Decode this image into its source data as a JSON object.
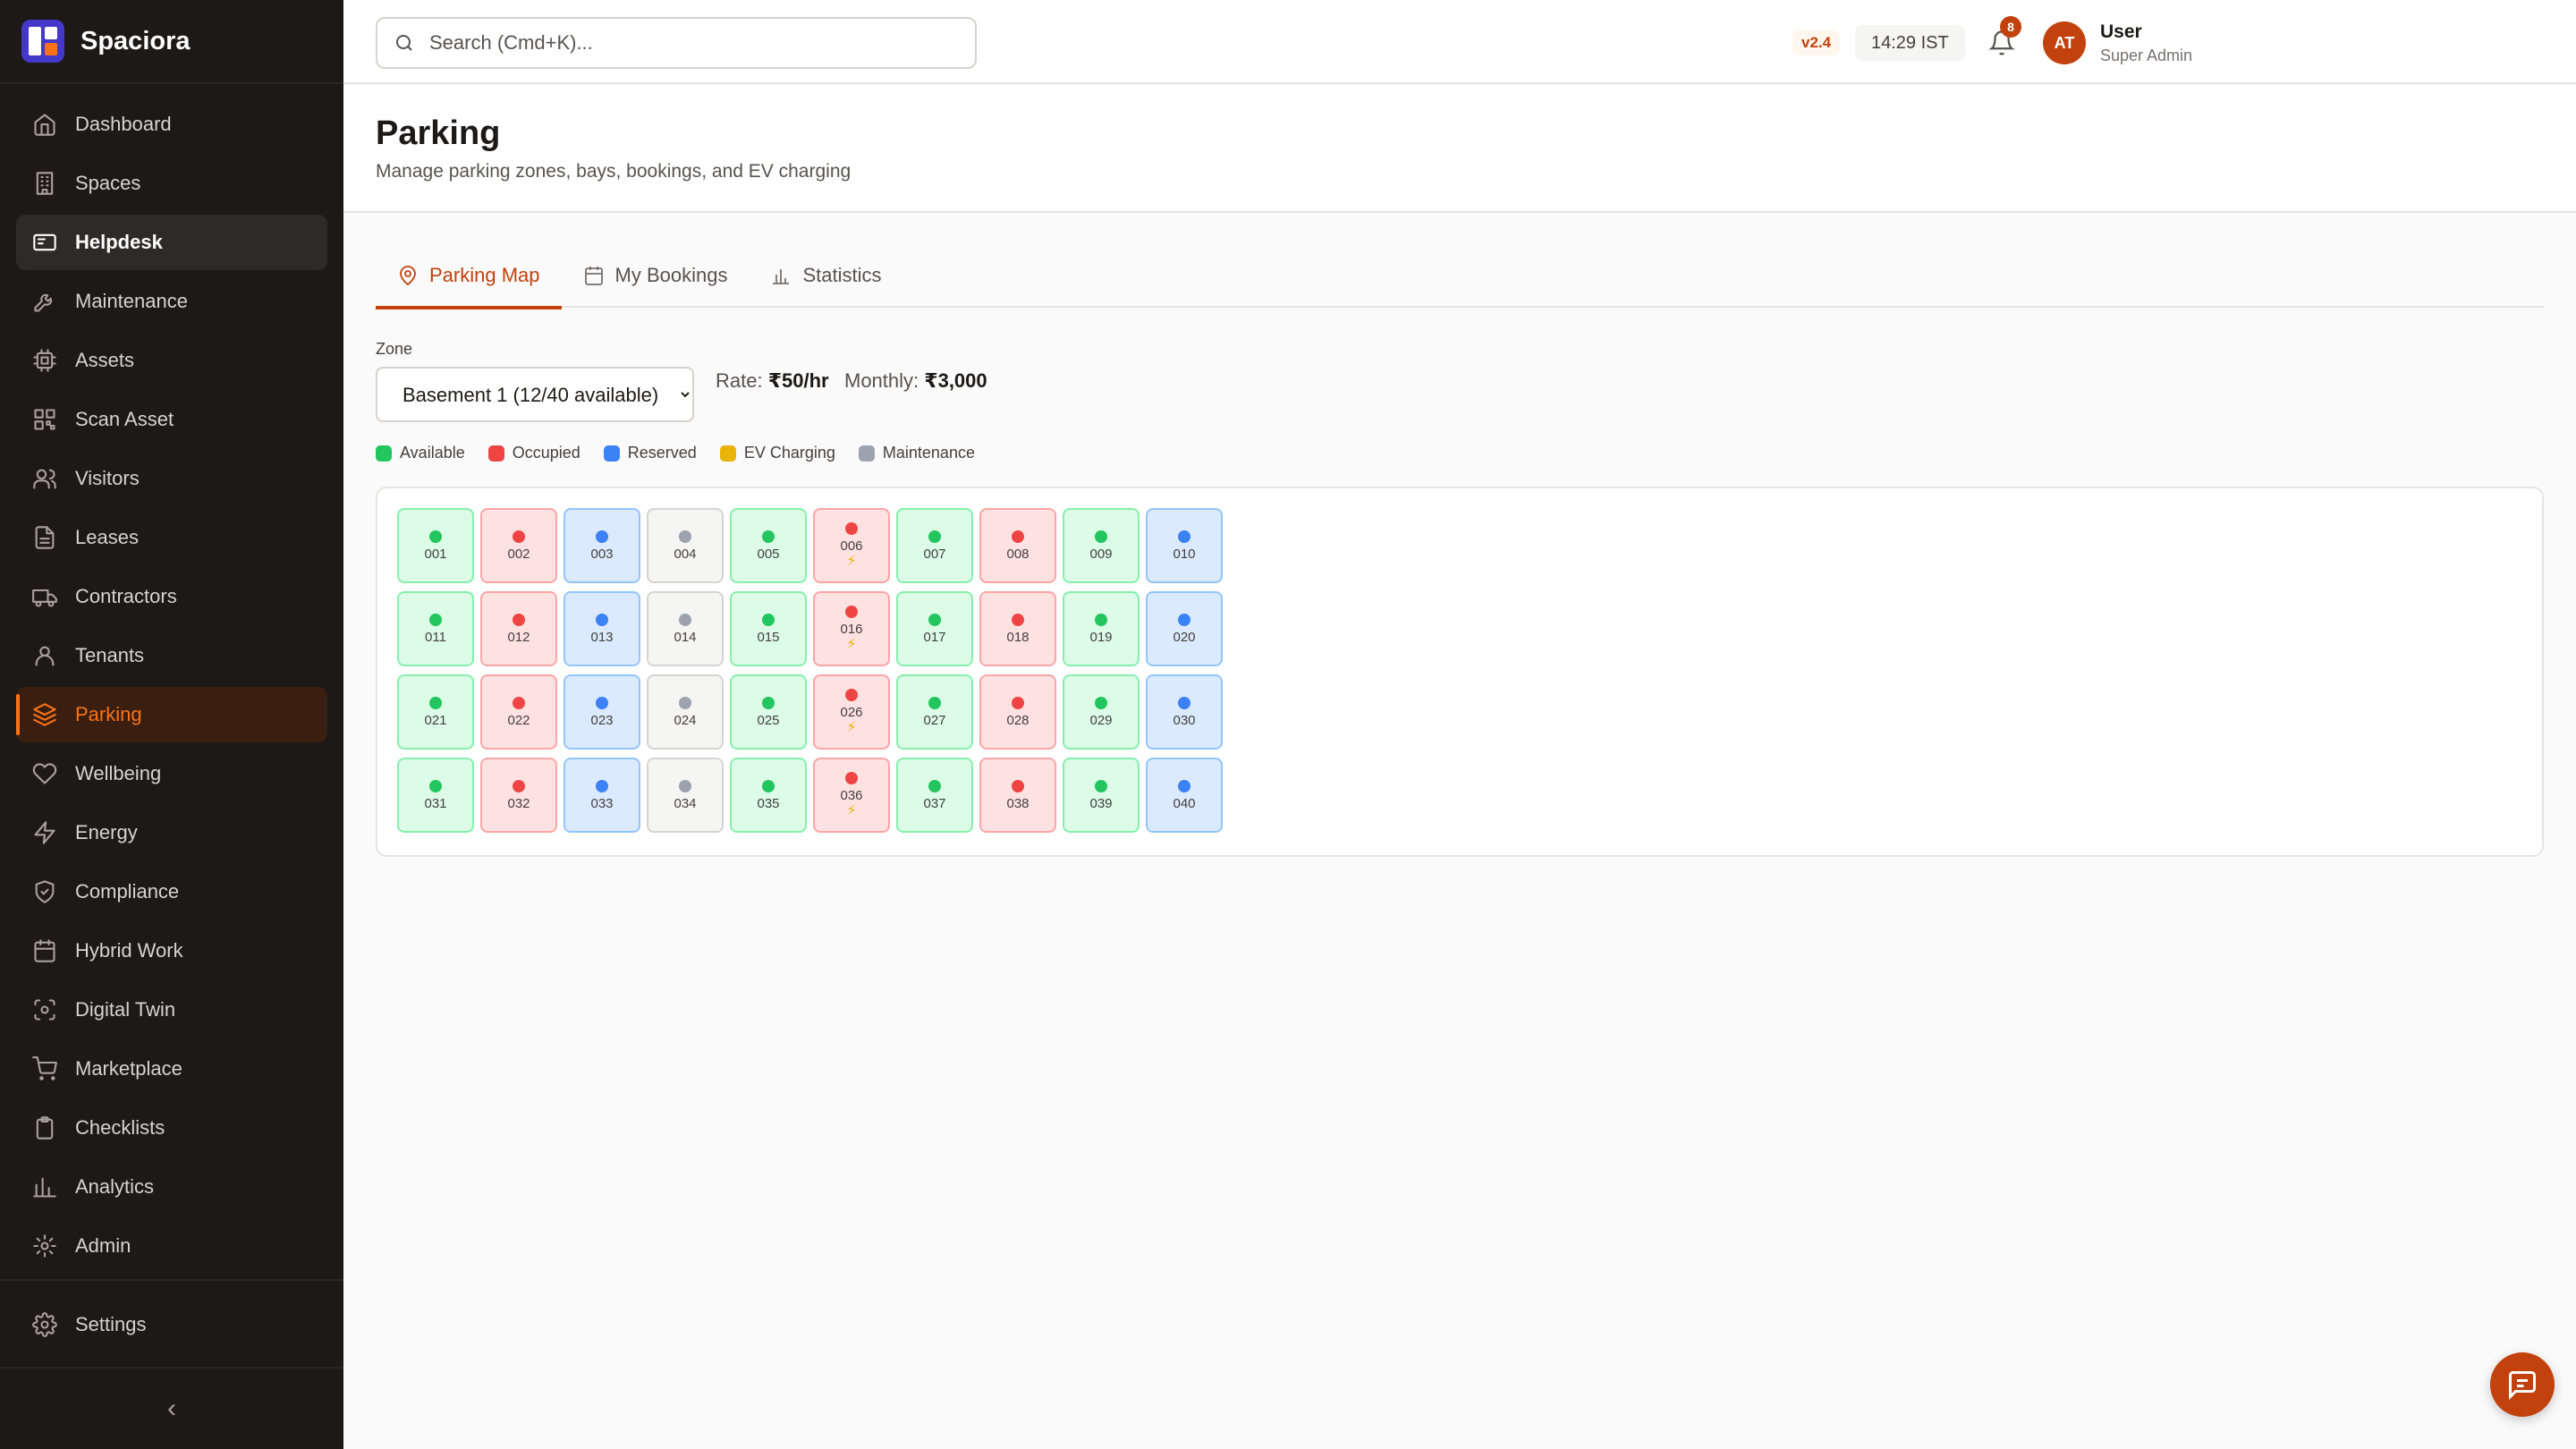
{
  "app": {
    "name": "Spaciora"
  },
  "sidebar": {
    "items": [
      {
        "label": "Dashboard",
        "icon": "home-icon"
      },
      {
        "label": "Spaces",
        "icon": "building-icon"
      },
      {
        "label": "Helpdesk",
        "icon": "ticket-icon"
      },
      {
        "label": "Maintenance",
        "icon": "wrench-icon"
      },
      {
        "label": "Assets",
        "icon": "cpu-icon"
      },
      {
        "label": "Scan Asset",
        "icon": "qr-icon"
      },
      {
        "label": "Visitors",
        "icon": "users-icon"
      },
      {
        "label": "Leases",
        "icon": "file-icon"
      },
      {
        "label": "Contractors",
        "icon": "truck-icon"
      },
      {
        "label": "Tenants",
        "icon": "user-icon"
      },
      {
        "label": "Parking",
        "icon": "layers-icon"
      },
      {
        "label": "Wellbeing",
        "icon": "heart-icon"
      },
      {
        "label": "Energy",
        "icon": "bolt-icon"
      },
      {
        "label": "Compliance",
        "icon": "shield-icon"
      },
      {
        "label": "Hybrid Work",
        "icon": "calendar-icon"
      },
      {
        "label": "Digital Twin",
        "icon": "box-icon"
      },
      {
        "label": "Marketplace",
        "icon": "cart-icon"
      },
      {
        "label": "Checklists",
        "icon": "clipboard-icon"
      },
      {
        "label": "Analytics",
        "icon": "chart-icon"
      },
      {
        "label": "Admin",
        "icon": "gear-icon"
      }
    ],
    "settings_label": "Settings",
    "active": "Parking",
    "hovered": "Helpdesk"
  },
  "topbar": {
    "search_placeholder": "Search (Cmd+K)...",
    "version": "v2.4",
    "time": "14:29 IST",
    "notification_count": "8",
    "user": {
      "initials": "AT",
      "name": "User",
      "role": "Super Admin"
    }
  },
  "page": {
    "title": "Parking",
    "subtitle": "Manage parking zones, bays, bookings, and EV charging"
  },
  "tabs": [
    {
      "label": "Parking Map",
      "icon": "map-pin-icon",
      "active": true
    },
    {
      "label": "My Bookings",
      "icon": "calendar-icon",
      "active": false
    },
    {
      "label": "Statistics",
      "icon": "bar-chart-icon",
      "active": false
    }
  ],
  "zone": {
    "label": "Zone",
    "selected": "Basement 1 (12/40 available)",
    "rate_label": "Rate:",
    "rate_value": "₹50/hr",
    "monthly_label": "Monthly:",
    "monthly_value": "₹3,000"
  },
  "legend": [
    {
      "label": "Available",
      "color": "#22c55e"
    },
    {
      "label": "Occupied",
      "color": "#ef4444"
    },
    {
      "label": "Reserved",
      "color": "#3b82f6"
    },
    {
      "label": "EV Charging",
      "color": "#eab308"
    },
    {
      "label": "Maintenance",
      "color": "#9ca3af"
    }
  ],
  "bays": {
    "column_status": [
      "available",
      "occupied",
      "reserved",
      "maintenance",
      "available",
      "occupied",
      "available",
      "occupied",
      "available",
      "reserved"
    ],
    "ev_column": 5,
    "rows": [
      [
        "001",
        "002",
        "003",
        "004",
        "005",
        "006",
        "007",
        "008",
        "009",
        "010"
      ],
      [
        "011",
        "012",
        "013",
        "014",
        "015",
        "016",
        "017",
        "018",
        "019",
        "020"
      ],
      [
        "021",
        "022",
        "023",
        "024",
        "025",
        "026",
        "027",
        "028",
        "029",
        "030"
      ],
      [
        "031",
        "032",
        "033",
        "034",
        "035",
        "036",
        "037",
        "038",
        "039",
        "040"
      ]
    ],
    "ev_glyph": "⚡"
  }
}
